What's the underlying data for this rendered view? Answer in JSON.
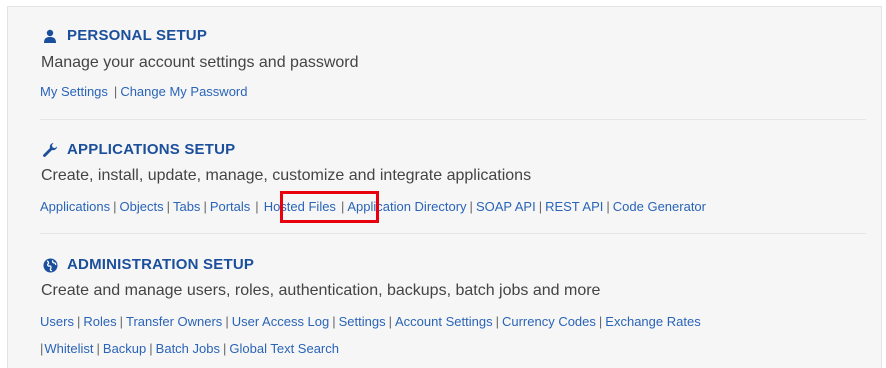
{
  "personal": {
    "title": "PERSONAL SETUP",
    "description": "Manage your account settings and password",
    "links": [
      "My Settings",
      "Change My Password"
    ]
  },
  "applications": {
    "title": "APPLICATIONS SETUP",
    "description": "Create, install, update, manage, customize and integrate applications",
    "links": [
      "Applications",
      "Objects",
      "Tabs",
      "Portals",
      "Hosted Files",
      "Application Directory",
      "SOAP API",
      "REST API",
      "Code Generator"
    ],
    "highlighted_link": "Hosted Files"
  },
  "administration": {
    "title": "ADMINISTRATION SETUP",
    "description": "Create and manage users, roles, authentication, backups, batch jobs and more",
    "links_row1": [
      "Users",
      "Roles",
      "Transfer Owners",
      "User Access Log",
      "Settings",
      "Account Settings",
      "Currency Codes",
      "Exchange Rates"
    ],
    "links_row2": [
      "Whitelist",
      "Backup",
      "Batch Jobs",
      "Global Text Search"
    ]
  },
  "colors": {
    "heading": "#1b4f9c",
    "link": "#2a64b8",
    "highlight_border": "#e8000d"
  },
  "icons": {
    "personal": "user-icon",
    "applications": "wrench-icon",
    "administration": "globe-icon"
  }
}
